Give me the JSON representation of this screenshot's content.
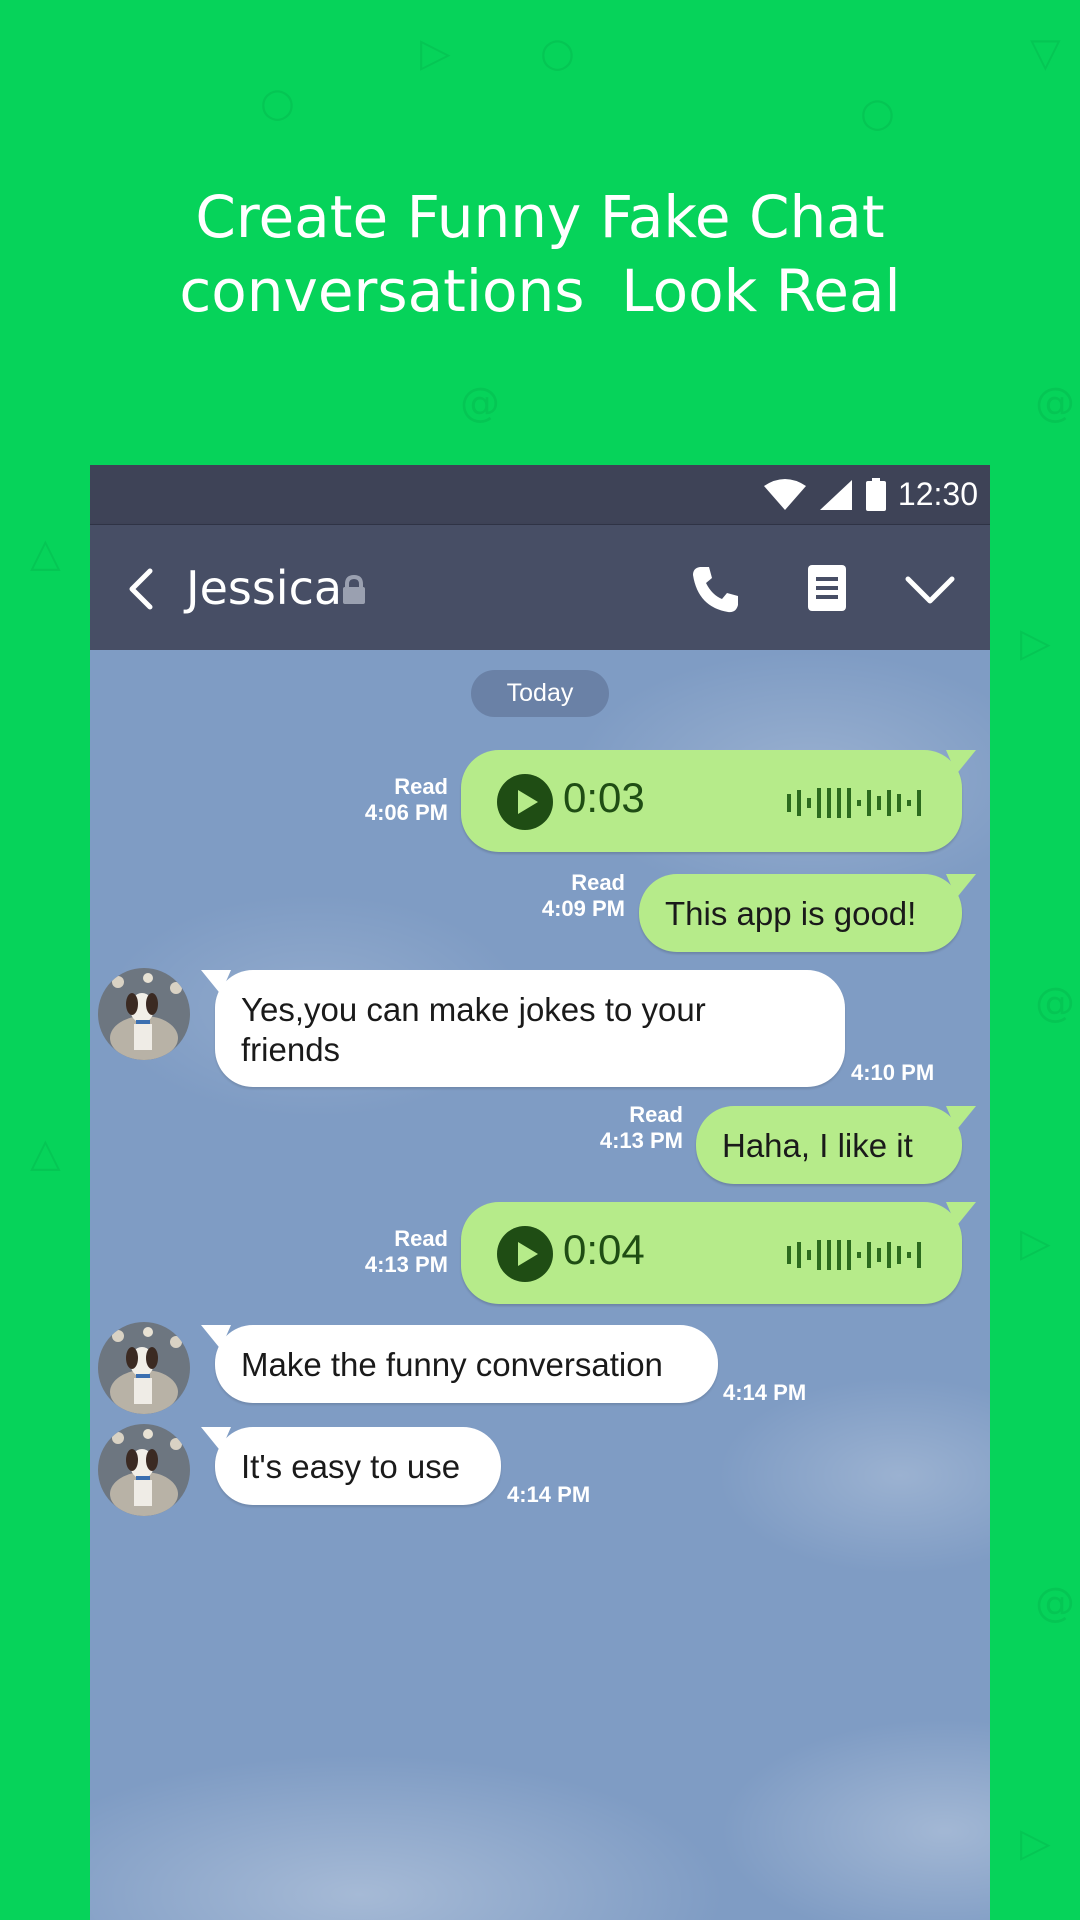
{
  "promo": {
    "line1": "Create Funny Fake Chat",
    "line2": "conversations  Look Real"
  },
  "status_bar": {
    "time": "12:30"
  },
  "app_bar": {
    "contact_name": "Jessica"
  },
  "chat": {
    "date_divider": "Today",
    "messages": [
      {
        "direction": "out",
        "type": "voice",
        "duration": "0:03",
        "read": "Read",
        "time": "4:06 PM"
      },
      {
        "direction": "out",
        "type": "text",
        "text": "This app is good!",
        "read": "Read",
        "time": "4:09 PM"
      },
      {
        "direction": "in",
        "type": "text",
        "line1": "Yes,you can make jokes to your",
        "line2": "friends",
        "time": "4:10 PM"
      },
      {
        "direction": "out",
        "type": "text",
        "text": "Haha, I like it",
        "read": "Read",
        "time": "4:13 PM"
      },
      {
        "direction": "out",
        "type": "voice",
        "duration": "0:04",
        "read": "Read",
        "time": "4:13 PM"
      },
      {
        "direction": "in",
        "type": "text",
        "text": "Make the funny conversation",
        "time": "4:14 PM"
      },
      {
        "direction": "in",
        "type": "text",
        "text": "It's easy to use",
        "time": "4:14 PM"
      }
    ]
  },
  "colors": {
    "background": "#06d35a",
    "status_bar": "#3e4357",
    "app_bar": "#474e65",
    "chat_bg": "#7f9cc4",
    "outgoing_bubble": "#b6eb8a",
    "incoming_bubble": "#ffffff"
  },
  "icons": [
    "wifi-icon",
    "signal-icon",
    "battery-icon",
    "back-arrow-icon",
    "lock-icon",
    "phone-icon",
    "memo-icon",
    "chevron-down-icon",
    "play-icon",
    "waveform-icon"
  ]
}
